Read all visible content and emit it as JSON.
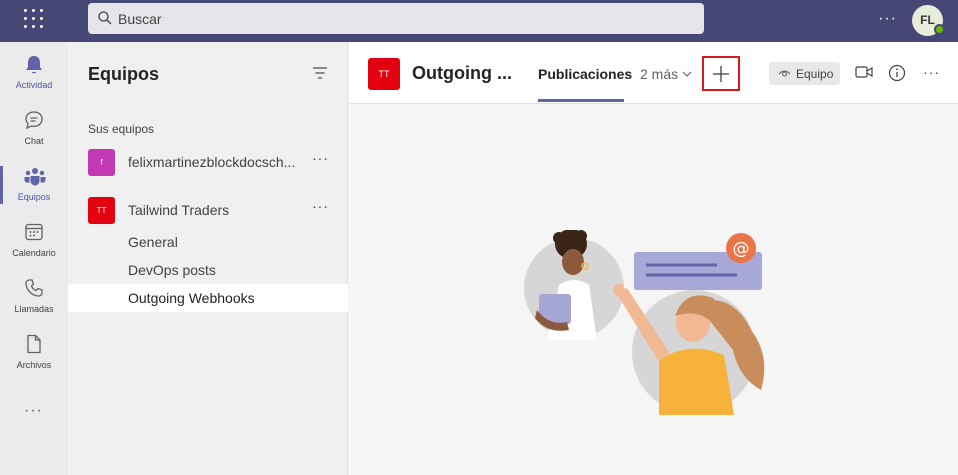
{
  "search": {
    "placeholder": "Buscar",
    "icon": "search-icon"
  },
  "topbar": {
    "more": "···",
    "avatar_initials": "FL"
  },
  "rail": {
    "items": [
      {
        "label": "Actividad",
        "icon": "bell-icon"
      },
      {
        "label": "Chat",
        "icon": "chat-icon"
      },
      {
        "label": "Equipos",
        "icon": "teams-icon"
      },
      {
        "label": "Calendario",
        "icon": "calendar-icon"
      },
      {
        "label": "Llamadas",
        "icon": "phone-icon"
      },
      {
        "label": "Archivos",
        "icon": "file-icon"
      }
    ],
    "more": "···"
  },
  "panel": {
    "title": "Equipos",
    "section_label": "Sus equipos",
    "teams": [
      {
        "initials": "f",
        "name": "felixmartinezblockdocsch...",
        "more": "···",
        "color": "#c239b3"
      },
      {
        "initials": "TT",
        "name": "Tailwind Traders",
        "more": "···",
        "color": "#e3000f"
      }
    ],
    "channels": [
      "General",
      "DevOps posts",
      "Outgoing Webhooks"
    ]
  },
  "header": {
    "tile_initials": "TT",
    "channel_title": "Outgoing ...",
    "tab_active": "Publicaciones",
    "tab_more": "2 más",
    "team_button": "Equipo",
    "more": "···"
  },
  "colors": {
    "brand": "#464775",
    "accent": "#6264a7",
    "highlight_box": "#d61a1a"
  }
}
